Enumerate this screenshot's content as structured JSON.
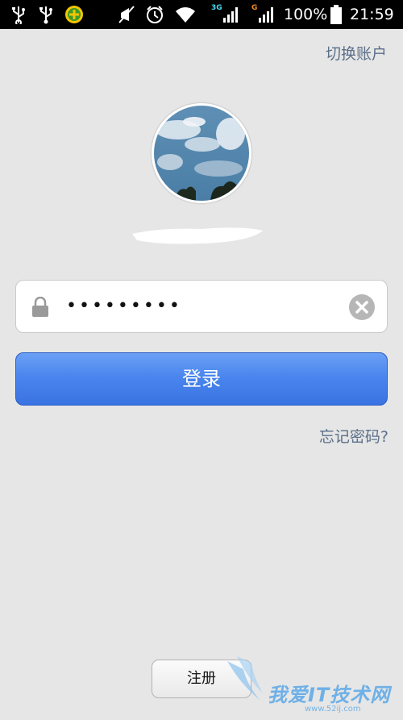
{
  "status_bar": {
    "battery_text": "100%",
    "time": "21:59",
    "net_label_1": "3G",
    "net_label_2": "G",
    "icons": [
      "usb-icon",
      "usb-icon",
      "app-notification-icon",
      "mute-icon",
      "alarm-icon",
      "wifi-icon",
      "signal-3g-icon",
      "signal-g-icon",
      "battery-icon"
    ]
  },
  "header": {
    "switch_account_label": "切换账户"
  },
  "login": {
    "password_value": "•••••••••",
    "login_label": "登录",
    "forgot_label": "忘记密码?"
  },
  "footer": {
    "register_label": "注册"
  },
  "watermark": {
    "text": "我爱IT技术网",
    "sub": "www.52ij.com"
  },
  "colors": {
    "background": "#e6e6e6",
    "link": "#5c6f8a",
    "primary_button": "#4a86ee",
    "status_bar": "#000000"
  }
}
